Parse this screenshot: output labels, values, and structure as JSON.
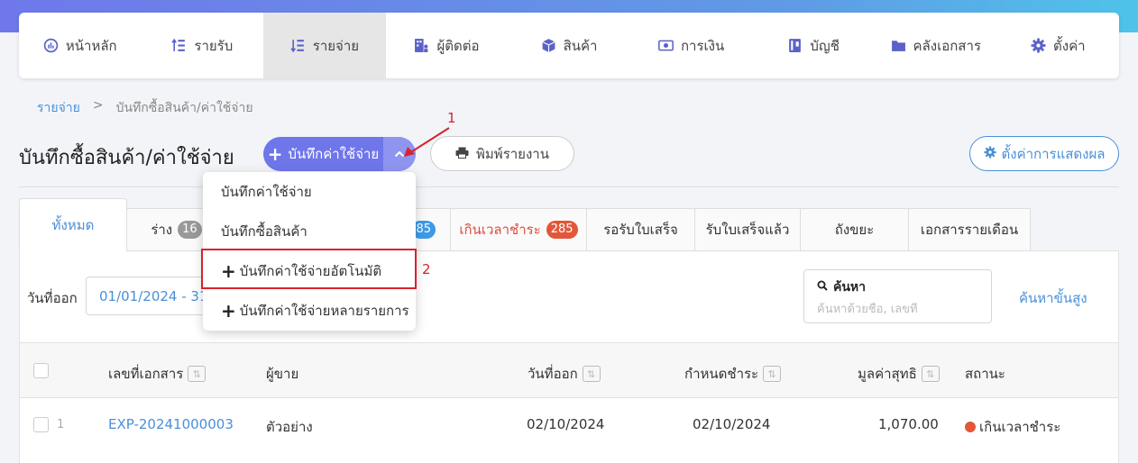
{
  "nav": {
    "items": [
      {
        "label": "หน้าหลัก",
        "icon": "dashboard-icon",
        "active": false
      },
      {
        "label": "รายรับ",
        "icon": "income-icon",
        "active": false
      },
      {
        "label": "รายจ่าย",
        "icon": "expense-icon",
        "active": true
      },
      {
        "label": "ผู้ติดต่อ",
        "icon": "contacts-icon",
        "active": false
      },
      {
        "label": "สินค้า",
        "icon": "box-icon",
        "active": false
      },
      {
        "label": "การเงิน",
        "icon": "money-icon",
        "active": false
      },
      {
        "label": "บัญชี",
        "icon": "book-icon",
        "active": false
      },
      {
        "label": "คลังเอกสาร",
        "icon": "folder-icon",
        "active": false
      },
      {
        "label": "ตั้งค่า",
        "icon": "gear-icon",
        "active": false
      }
    ]
  },
  "breadcrumb": {
    "root": "รายจ่าย",
    "separator": ">",
    "current": "บันทึกซื้อสินค้า/ค่าใช้จ่าย"
  },
  "page": {
    "title": "บันทึกซื้อสินค้า/ค่าใช้จ่าย"
  },
  "toolbar": {
    "add_label": "บันทึกค่าใช้จ่าย",
    "add_icon": "plus-icon",
    "caret_icon": "chevron-up-icon",
    "print_label": "พิมพ์รายงาน",
    "print_icon": "printer-icon",
    "display_label": "ตั้งค่าการแสดงผล",
    "display_icon": "gear-icon"
  },
  "tabs": [
    {
      "label": "ทั้งหมด",
      "badge": ""
    },
    {
      "label": "ร่าง",
      "badge": "16"
    },
    {
      "label": "",
      "badge": "85"
    },
    {
      "label": "เกินเวลาชำระ",
      "badge": "285"
    },
    {
      "label": "รอรับใบเสร็จ",
      "badge": ""
    },
    {
      "label": "รับใบเสร็จแล้ว",
      "badge": ""
    },
    {
      "label": "ถังขยะ",
      "badge": ""
    },
    {
      "label": "เอกสารรายเดือน",
      "badge": ""
    }
  ],
  "filters": {
    "date_label": "วันที่ออก",
    "date_value": "01/01/2024 - 31",
    "search_title": "ค้นหา",
    "search_placeholder": "ค้นหาด้วยชื่อ, เลขที่",
    "advanced_search": "ค้นหาขั้นสูง"
  },
  "table": {
    "headers": [
      "เลขที่เอกสาร",
      "ผู้ขาย",
      "วันที่ออก",
      "กำหนดชำระ",
      "มูลค่าสุทธิ",
      "สถานะ"
    ],
    "sort_glyph": "⇅",
    "rows": [
      {
        "num": "1",
        "doc": "EXP-20241000003",
        "vendor": "ตัวอย่าง",
        "issue": "02/10/2024",
        "due": "02/10/2024",
        "net": "1,070.00",
        "status": "เกินเวลาชำระ"
      }
    ]
  },
  "dropdown": {
    "items": [
      {
        "label": "บันทึกค่าใช้จ่าย",
        "plus": false
      },
      {
        "label": "บันทึกซื้อสินค้า",
        "plus": false
      },
      {
        "label": "บันทึกค่าใช้จ่ายอัตโนมัติ",
        "plus": true
      },
      {
        "label": "บันทึกค่าใช้จ่ายหลายรายการ",
        "plus": true
      }
    ]
  },
  "annotations": {
    "step1": "1",
    "step2": "2"
  },
  "colors": {
    "accent": "#6f76ea",
    "link": "#4a8fd8",
    "danger": "#e2573a",
    "annotation": "#d8232a"
  }
}
